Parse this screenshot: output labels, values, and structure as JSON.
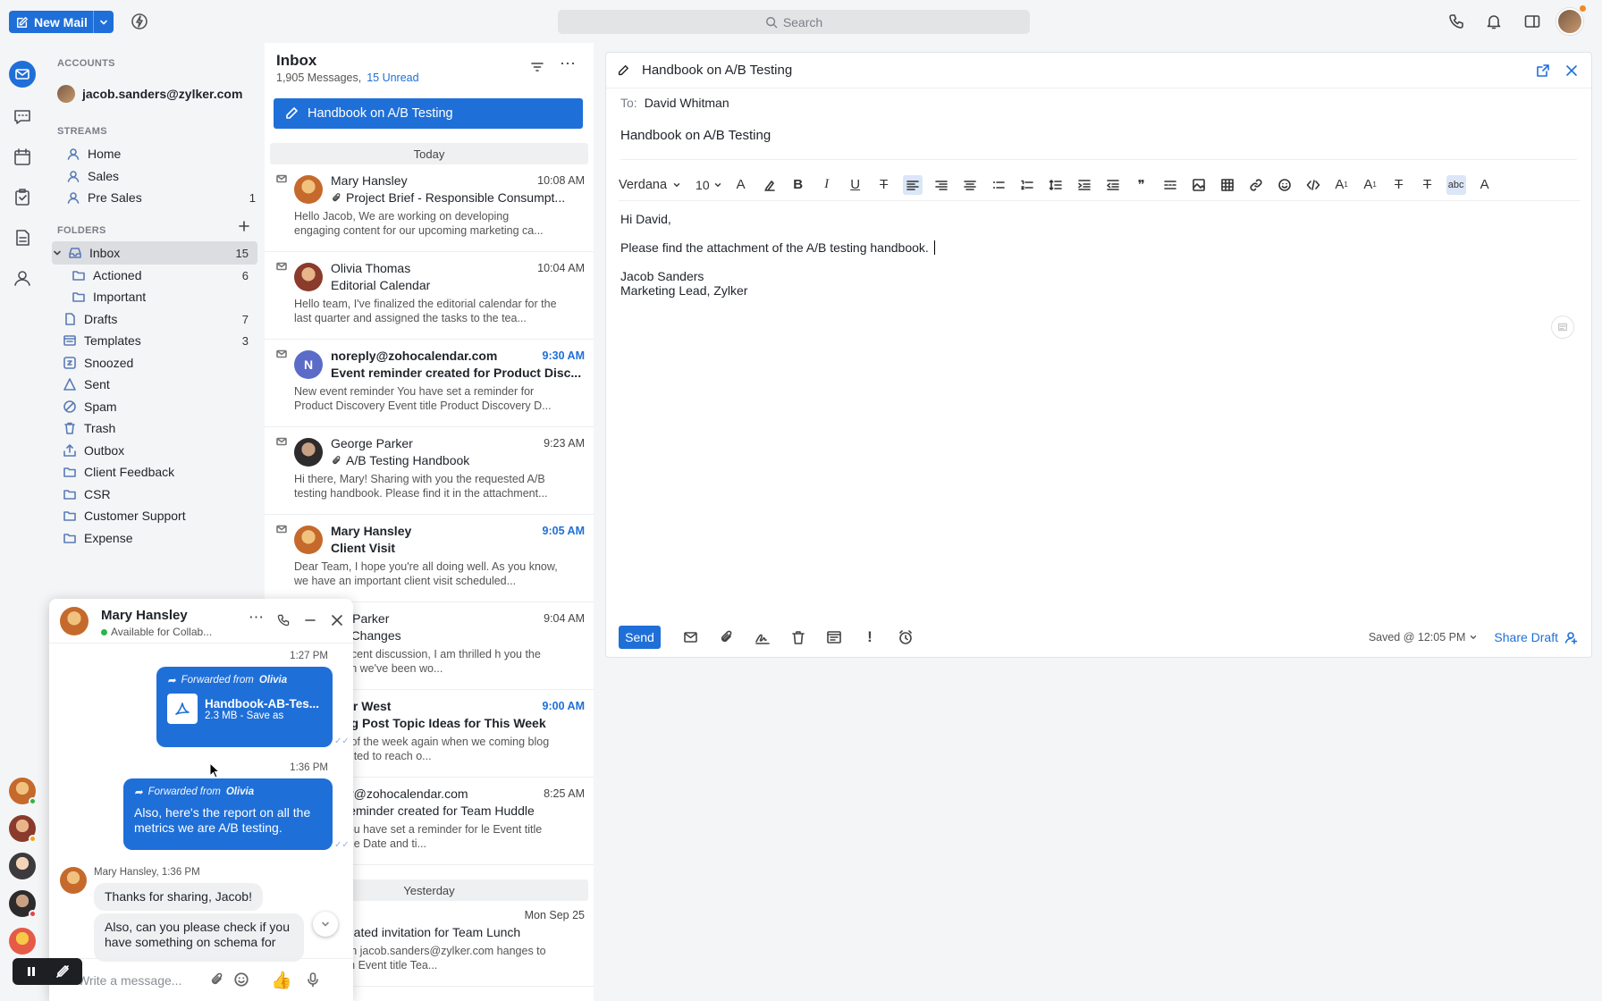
{
  "topbar": {
    "new_mail": "New Mail",
    "search_placeholder": "Search"
  },
  "accounts": {
    "heading": "ACCOUNTS",
    "email": "jacob.sanders@zylker.com"
  },
  "streams": {
    "heading": "STREAMS",
    "items": [
      {
        "label": "Home",
        "count": ""
      },
      {
        "label": "Sales",
        "count": ""
      },
      {
        "label": "Pre Sales",
        "count": "1"
      }
    ]
  },
  "folders": {
    "heading": "FOLDERS",
    "items": [
      {
        "label": "Inbox",
        "count": "15"
      },
      {
        "label": "Actioned",
        "count": "6"
      },
      {
        "label": "Important",
        "count": ""
      },
      {
        "label": "Drafts",
        "count": "7"
      },
      {
        "label": "Templates",
        "count": "3"
      },
      {
        "label": "Snoozed",
        "count": ""
      },
      {
        "label": "Sent",
        "count": ""
      },
      {
        "label": "Spam",
        "count": ""
      },
      {
        "label": "Trash",
        "count": ""
      },
      {
        "label": "Outbox",
        "count": ""
      },
      {
        "label": "Client Feedback",
        "count": ""
      },
      {
        "label": "CSR",
        "count": ""
      },
      {
        "label": "Customer Support",
        "count": ""
      },
      {
        "label": "Expense",
        "count": ""
      }
    ]
  },
  "list": {
    "title": "Inbox",
    "messages_count": "1,905 Messages,",
    "unread": "15 Unread",
    "draft_banner": "Handbook on A/B Testing",
    "today": "Today",
    "yesterday": "Yesterday",
    "mails": [
      {
        "from": "Mary Hansley",
        "time": "10:08 AM",
        "subject": "Project Brief - Responsible Consumpt...",
        "preview": "Hello Jacob, We are working on developing engaging content for our upcoming marketing ca...",
        "unread": false,
        "attachment": true
      },
      {
        "from": "Olivia Thomas",
        "time": "10:04 AM",
        "subject": "Editorial Calendar",
        "preview": "Hello team, I've finalized the editorial calendar for the last quarter and assigned the tasks to the tea...",
        "unread": false,
        "attachment": false
      },
      {
        "from": "noreply@zohocalendar.com",
        "time": "9:30 AM",
        "subject": "Event reminder created for Product Disc...",
        "preview": "New event reminder You have set a reminder for Product Discovery Event title Product Discovery D...",
        "unread": true,
        "attachment": false,
        "initial": "N"
      },
      {
        "from": "George Parker",
        "time": "9:23 AM",
        "subject": "A/B Testing Handbook",
        "preview": "Hi there, Mary! Sharing with you the requested A/B testing handbook. Please find it in the attachment...",
        "unread": false,
        "attachment": true
      },
      {
        "from": "Mary Hansley",
        "time": "9:05 AM",
        "subject": "Client Visit",
        "preview": "Dear Team, I hope you're all doing well. As you know, we have an important client visit scheduled...",
        "unread": true,
        "attachment": false
      },
      {
        "from": "rge Parker",
        "time": "9:04 AM",
        "subject": "ign Changes",
        "preview": "s per our recent discussion, I am thrilled h you the latest design we've been wo...",
        "unread": false,
        "attachment": false
      },
      {
        "from": "anor West",
        "time": "9:00 AM",
        "subject": "Blog Post Topic Ideas for This Week",
        "preview": "'s that time of the week again when we coming blog posts. I wanted to reach o...",
        "unread": true,
        "attachment": false
      },
      {
        "from": "eply@zohocalendar.com",
        "time": "8:25 AM",
        "subject": "nt reminder created for Team Huddle",
        "preview": "reminder You have set a reminder for le Event title Team Huddle Date and ti...",
        "unread": false,
        "attachment": false
      },
      {
        "from": "",
        "time": "Mon Sep 25",
        "subject": "Updated invitation for  Team Lunch",
        "preview": "ent invitation jacob.sanders@zylker.com hanges to Team Lunch Event title Tea...",
        "unread": false,
        "attachment": false
      }
    ]
  },
  "compose": {
    "title": "Handbook on A/B Testing",
    "to_label": "To:",
    "to": "David Whitman",
    "subject": "Handbook on A/B Testing",
    "font": "Verdana",
    "size": "10",
    "body": {
      "greeting": "Hi David,",
      "line": "Please find the attachment of the A/B testing handbook.",
      "sig_name": "Jacob Sanders",
      "sig_title": "Marketing Lead, Zylker"
    },
    "send": "Send",
    "saved": "Saved @ 12:05 PM",
    "share_draft": "Share Draft"
  },
  "chat": {
    "name": "Mary Hansley",
    "status": "Available for Collab...",
    "time1": "1:27 PM",
    "fwd_label": "Forwarded from",
    "fwd_from": "Olivia",
    "file_name": "Handbook-AB-Tes...",
    "file_meta": "2.3 MB - Save as",
    "time2": "1:36 PM",
    "msg2": "Also, here's the report on all the metrics we are A/B testing.",
    "sender_line": "Mary Hansley, 1:36 PM",
    "reply1": "Thanks for sharing, Jacob!",
    "reply2": "Also, can you please check if you have something on schema for",
    "input_placeholder": "Write a message..."
  },
  "colors": {
    "accent": "#1f6fd8",
    "online": "#2cb34a"
  }
}
